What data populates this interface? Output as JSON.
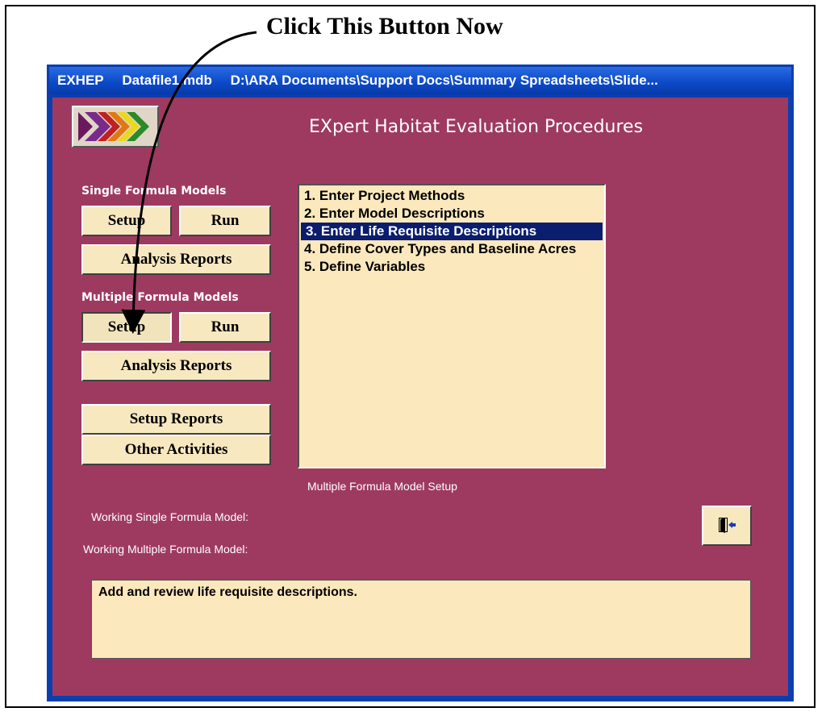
{
  "callout": {
    "text": "Click This Button Now"
  },
  "window": {
    "title_parts": [
      "EXHEP",
      "Datafile1.mdb",
      "D:\\ARA Documents\\Support Docs\\Summary Spreadsheets\\Slide..."
    ]
  },
  "app": {
    "title": "EXpert Habitat Evaluation Procedures",
    "logo_icon": "exhep-logo-arrows-icon"
  },
  "single_formula": {
    "label": "Single Formula Models",
    "setup": "Setup",
    "run": "Run",
    "analysis": "Analysis Reports"
  },
  "multiple_formula": {
    "label": "Multiple Formula Models",
    "setup": "Setup",
    "run": "Run",
    "analysis": "Analysis Reports"
  },
  "other": {
    "setup_reports": "Setup Reports",
    "other_activities": "Other Activities"
  },
  "list": {
    "items": [
      "1. Enter Project Methods",
      "2. Enter Model Descriptions",
      "3. Enter Life Requisite Descriptions",
      "4. Define Cover Types and Baseline Acres",
      "5. Define Variables"
    ],
    "selected_index": 2,
    "caption": "Multiple Formula Model Setup"
  },
  "status": {
    "working_single": "Working Single Formula Model:",
    "working_multiple": "Working Multiple Formula Model:"
  },
  "exit": {
    "icon": "exit-door-icon"
  },
  "description": {
    "text": "Add and review life requisite descriptions."
  },
  "colors": {
    "client_bg": "#9e3a60",
    "button_bg": "#f7e8c0",
    "list_bg": "#fbe8bc",
    "selection": "#0a1d6e",
    "titlebar": "#0b48c8"
  }
}
